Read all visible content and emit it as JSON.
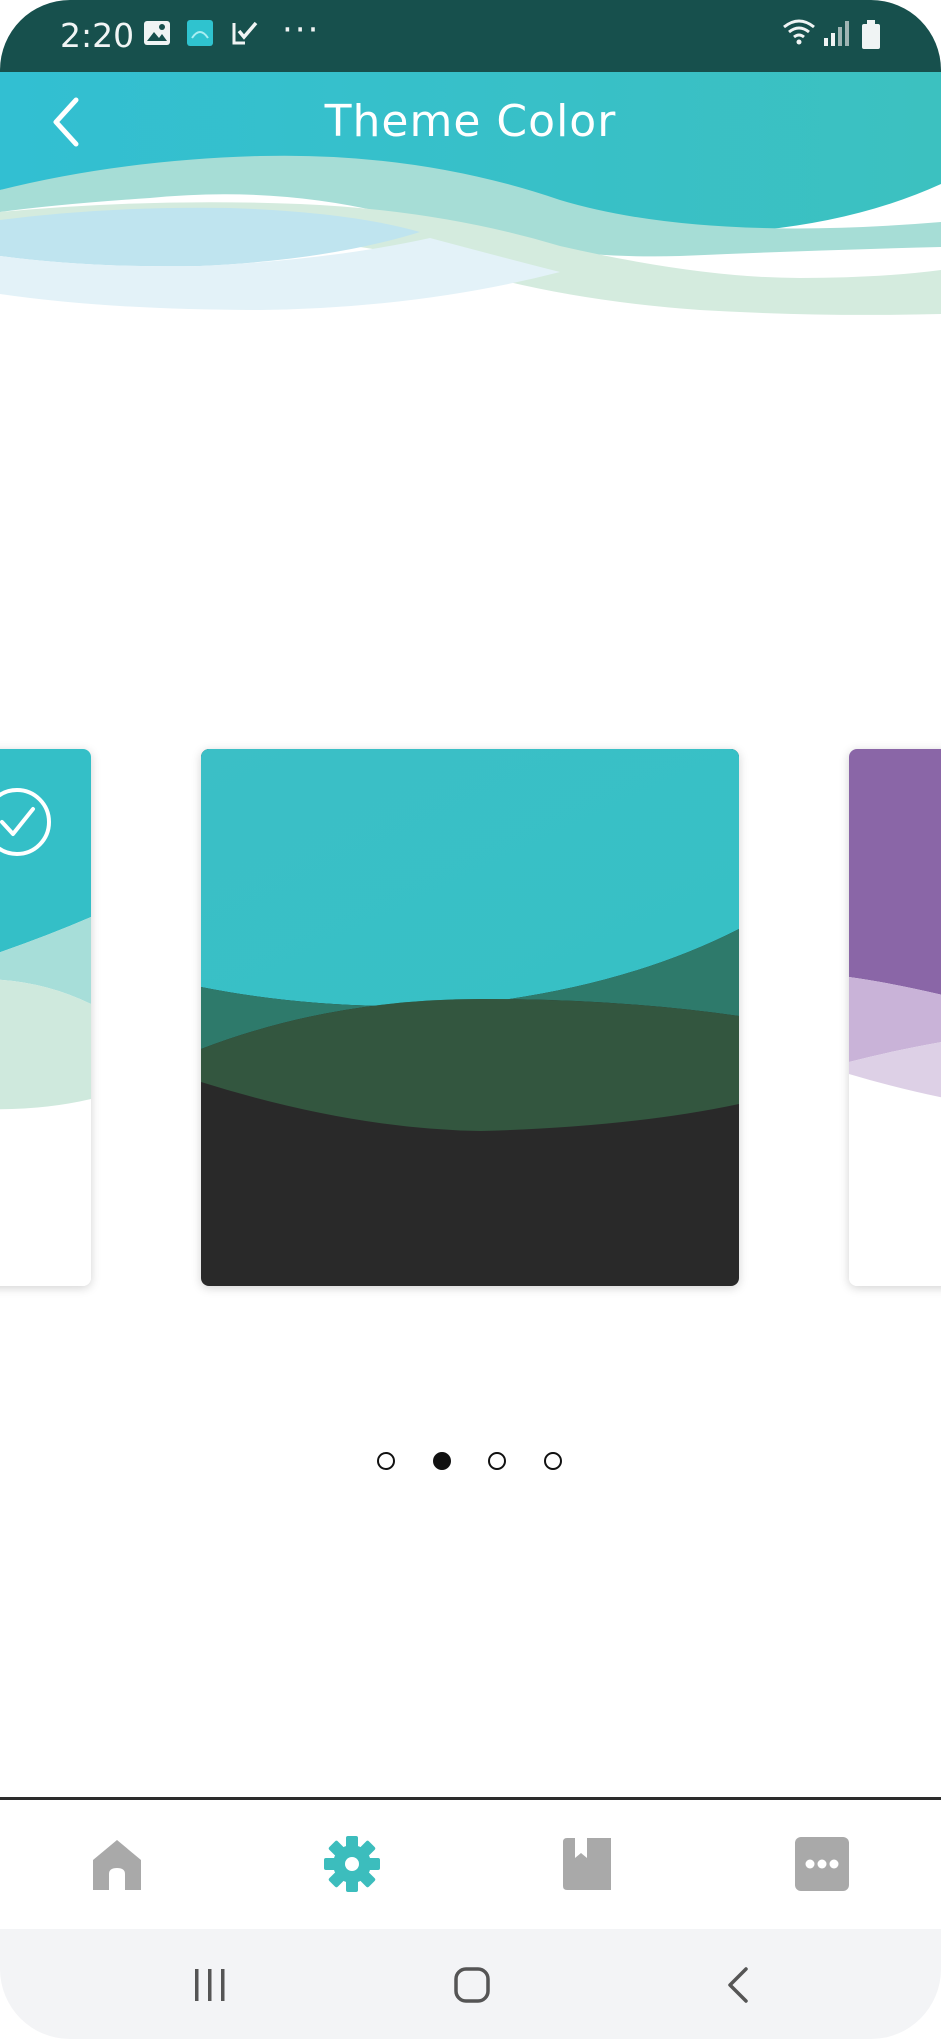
{
  "status_bar": {
    "time": "2:20",
    "icons": [
      "gallery-icon",
      "app-notification-icon",
      "task-check-icon",
      "more-notifications-icon",
      "wifi-icon",
      "signal-icon",
      "battery-icon"
    ],
    "more_glyph": "···"
  },
  "header": {
    "title": "Theme Color",
    "back_icon": "chevron-left-icon"
  },
  "themes": [
    {
      "name": "teal-light",
      "selected": true,
      "colors": [
        "#35bfc8",
        "#a7ded9",
        "#cfe9dd",
        "#ffffff"
      ]
    },
    {
      "name": "teal-dark",
      "selected": false,
      "colors": [
        "#37bec6",
        "#2e7a6b",
        "#33563f",
        "#292929"
      ]
    },
    {
      "name": "purple-light",
      "selected": false,
      "colors": [
        "#8a66a7",
        "#c9b3d8",
        "#ddd0e6",
        "#ffffff"
      ]
    }
  ],
  "pagination": {
    "count": 4,
    "active_index": 1
  },
  "bottom_nav": {
    "items": [
      {
        "icon": "home-icon",
        "active": false
      },
      {
        "icon": "settings-gear-icon",
        "active": true
      },
      {
        "icon": "bookmark-book-icon",
        "active": false
      },
      {
        "icon": "more-icon",
        "active": false
      }
    ],
    "active_color": "#3cbdbd",
    "inactive_color": "#a9a9a9"
  },
  "system_nav": [
    "recent-apps-icon",
    "home-button-icon",
    "back-icon"
  ],
  "colors": {
    "status_bar_bg": "#17504d",
    "accent": "#36c0c5"
  }
}
